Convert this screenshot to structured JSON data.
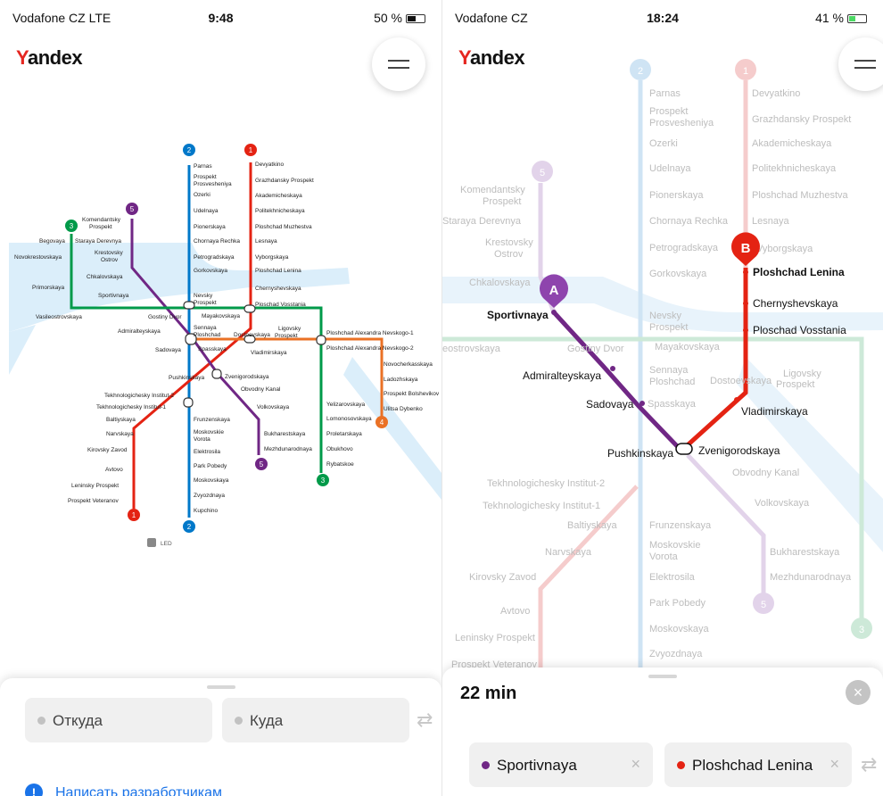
{
  "left": {
    "status": {
      "carrier": "Vodafone CZ  LTE",
      "time": "9:48",
      "battery": "50 %",
      "battery_fill": 0.5
    },
    "logo": {
      "text": "Yandex"
    },
    "map_labels": {
      "line1": "1",
      "line2": "2",
      "line3": "3",
      "line4": "4",
      "line5": "5",
      "led": "LED",
      "parnas": "Parnas",
      "prosp1": "Prospekt",
      "prosp2": "Prosvesheniya",
      "ozerki": "Ozerki",
      "udelnaya": "Udelnaya",
      "pionerskaya": "Pionerskaya",
      "chornaya": "Chornaya Rechka",
      "petrogradskaya": "Petrogradskaya",
      "gorkovskaya": "Gorkovskaya",
      "nevsky1": "Nevsky",
      "nevsky2": "Prospekt",
      "sennaya1": "Sennaya",
      "sennaya2": "Ploshchad",
      "frunzenskaya": "Frunzenskaya",
      "moskovskie1": "Moskovskie",
      "moskovskie2": "Vorota",
      "elektrosila": "Elektrosila",
      "park_pobedy": "Park Pobedy",
      "moskovskaya": "Moskovskaya",
      "zvyozdnaya": "Zvyozdnaya",
      "kupchino": "Kupchino",
      "devyatkino": "Devyatkino",
      "grazhdansky": "Grazhdansky Prospekt",
      "akadem": "Akademicheskaya",
      "politekh": "Politekhnicheskaya",
      "muzhestva": "Ploshchad Muzhestva",
      "lesnaya": "Lesnaya",
      "vyborgskaya": "Vyborgskaya",
      "lenina": "Ploshchad Lenina",
      "chernyshevskaya": "Chernyshevskaya",
      "vosstania": "Ploschad Vosstania",
      "vladimirskaya": "Vladimirskaya",
      "pushkinskaya": "Pushkinskaya",
      "tekh2": "Tekhnologichesky Institut-2",
      "tekh1": "Tekhnologichesky Institut-1",
      "baltiyskaya": "Baltiyskaya",
      "narvskaya": "Narvskaya",
      "kirovsky": "Kirovsky Zavod",
      "avtovo": "Avtovo",
      "leninsky": "Leninsky Prospekt",
      "veteranov": "Prospekt Veteranov",
      "komend1": "Komendantsky",
      "komend2": "Prospekt",
      "krest1": "Krestovsky",
      "krest2": "Ostrov",
      "chkalovskaya": "Chkalovskaya",
      "sportivnaya": "Sportivnaya",
      "admiralteyskaya": "Admiralteyskaya",
      "sadovaya": "Sadovaya",
      "zvenigorodskaya": "Zvenigorodskaya",
      "obvodny": "Obvodny Kanal",
      "volkovskaya": "Volkovskaya",
      "bukharestskaya": "Bukharestskaya",
      "mezhdunarodnaya": "Mezhdunarodnaya",
      "begovaya": "Begovaya",
      "staraya": "Staraya Derevnya",
      "novokrest": "Novokrestovskaya",
      "primorskaya": "Primorskaya",
      "vasileo": "Vasileostrovskaya",
      "gostiny": "Gostiny Dvor",
      "mayakovskaya": "Mayakovskaya",
      "spasskaya": "Spasskaya",
      "dostoevskaya": "Dostoevskaya",
      "ligovsky1": "Ligovsky",
      "ligovsky2": "Prospekt",
      "alex1": "Ploshchad Alexandra Nevskogo-1",
      "alex2": "Ploshchad Alexandra Nevskogo-2",
      "elizarovskaya": "Yelizarovskaya",
      "lomonosovskaya": "Lomonosovskaya",
      "proletarskaya": "Proletarskaya",
      "obukhovo": "Obukhovo",
      "rybatskoe": "Rybatskoe",
      "novocherk": "Novocherkasskaya",
      "ladozhskaya": "Ladozhskaya",
      "bolshevikov": "Prospekt Bolshevikov",
      "dybenko": "Ulitsa Dybenko"
    },
    "sheet": {
      "from_placeholder": "Откуда",
      "to_placeholder": "Куда",
      "swap_icon": "⇄",
      "feedback": "Написать разработчикам",
      "info_icon": "!"
    }
  },
  "right": {
    "status": {
      "carrier": "Vodafone CZ",
      "time": "18:24",
      "battery": "41 %",
      "battery_fill": 0.41
    },
    "logo": {
      "text": "Yandex"
    },
    "markers": {
      "a": "A",
      "b": "B"
    },
    "map_labels": {
      "line1": "1",
      "line2": "2",
      "line3": "3",
      "line5": "5",
      "parnas": "Parnas",
      "prosp1": "Prospekt",
      "prosp2": "Prosvesheniya",
      "ozerki": "Ozerki",
      "udelnaya": "Udelnaya",
      "pionerskaya": "Pionerskaya",
      "chornaya": "Chornaya Rechka",
      "petrogradskaya": "Petrogradskaya",
      "gorkovskaya": "Gorkovskaya",
      "nevsky1": "Nevsky",
      "nevsky2": "Prospekt",
      "sennaya1": "Sennaya",
      "sennaya2": "Ploshchad",
      "devyatkino": "Devyatkino",
      "grazhdansky": "Grazhdansky Prospekt",
      "akadem": "Akademicheskaya",
      "politekh": "Politekhnicheskaya",
      "muzhestva": "Ploshchad Muzhestva",
      "lesnaya": "Lesnaya",
      "vyborgskaya": "Vyborgskaya",
      "lenina": "Ploshchad Lenina",
      "chernyshevskaya": "Chernyshevskaya",
      "vosstania": "Ploschad Vosstania",
      "vladimirskaya": "Vladimirskaya",
      "pushkinskaya": "Pushkinskaya",
      "zvenigorodskaya": "Zvenigorodskaya",
      "obvodny": "Obvodny Kanal",
      "volkovskaya": "Volkovskaya",
      "tekh2": "Tekhnologichesky Institut-2",
      "tekh1": "Tekhnologichesky Institut-1",
      "baltiyskaya": "Baltiyskaya",
      "narvskaya": "Narvskaya",
      "kirovsky": "Kirovsky Zavod",
      "avtovo": "Avtovo",
      "leninsky": "Leninsky Prospekt",
      "veteranov": "Prospekt Veteranov",
      "frunzenskaya": "Frunzenskaya",
      "moskovskie1": "Moskovskie",
      "moskovskie2": "Vorota",
      "elektrosila": "Elektrosila",
      "park_pobedy": "Park Pobedy",
      "moskovskaya": "Moskovskaya",
      "zvyozdnaya": "Zvyozdnaya",
      "bukharestskaya": "Bukharestskaya",
      "mezhdunarodnaya": "Mezhdunarodnaya",
      "komend1": "Komendantsky",
      "komend2": "Prospekt",
      "staraya": "Staraya Derevnya",
      "krest1": "Krestovsky",
      "krest2": "Ostrov",
      "chkalovskaya": "Chkalovskaya",
      "sportivnaya": "Sportivnaya",
      "admiralteyskaya": "Admiralteyskaya",
      "sadovaya": "Sadovaya",
      "spasskaya": "Spasskaya",
      "vasileo": "eostrovskaya",
      "gostiny": "Gostiny Dvor",
      "mayakovskaya": "Mayakovskaya",
      "dostoevskaya": "Dostoevskaya",
      "ligovsky1": "Ligovsky",
      "ligovsky2": "Prospekt"
    },
    "sheet": {
      "duration": "22 min",
      "from_station": "Sportivnaya",
      "to_station": "Ploshchad Lenina",
      "clear_icon": "×",
      "swap_icon": "⇄",
      "close_icon": "×"
    }
  },
  "colors": {
    "line1": "#e42313",
    "line2": "#0078c9",
    "line3": "#009a49",
    "line4": "#ea7125",
    "line5": "#702785",
    "link": "#1a73e8"
  }
}
